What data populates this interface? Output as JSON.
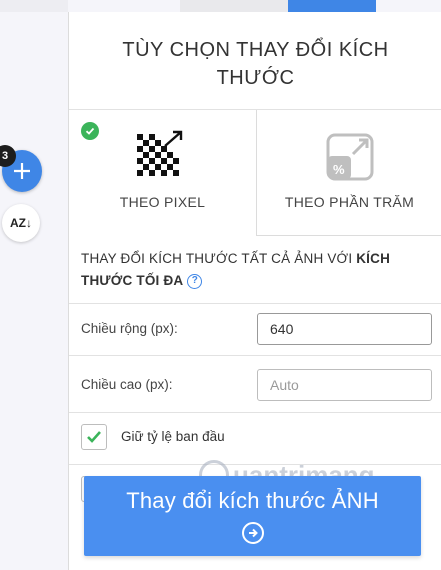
{
  "panel": {
    "title": "TÙY CHỌN THAY ĐỔI KÍCH THƯỚC"
  },
  "sidebar": {
    "badge_count": "3",
    "sort_label": "AZ↓"
  },
  "options": [
    {
      "label": "THEO PIXEL",
      "selected": true,
      "icon": "pixel-resize-icon"
    },
    {
      "label": "THEO PHẦN TRĂM",
      "selected": false,
      "icon": "percent-resize-icon"
    }
  ],
  "description": {
    "text": "THAY ĐỔI KÍCH THƯỚC TẤT CẢ ẢNH VỚI ",
    "bold": "KÍCH THƯỚC TỐI ĐA",
    "help": "?"
  },
  "fields": {
    "width_label": "Chiều rộng (px):",
    "width_value": "640",
    "height_label": "Chiều cao (px):",
    "height_placeholder": "Auto"
  },
  "checkbox": {
    "label": "Giữ tỷ lệ ban đầu",
    "checked": true
  },
  "watermark": {
    "text": "uantrimang"
  },
  "submit": {
    "label": "Thay đổi kích thước ẢNH"
  },
  "colors": {
    "accent": "#3f86e6",
    "button": "#4a8ff0",
    "check": "#3bb45a"
  }
}
